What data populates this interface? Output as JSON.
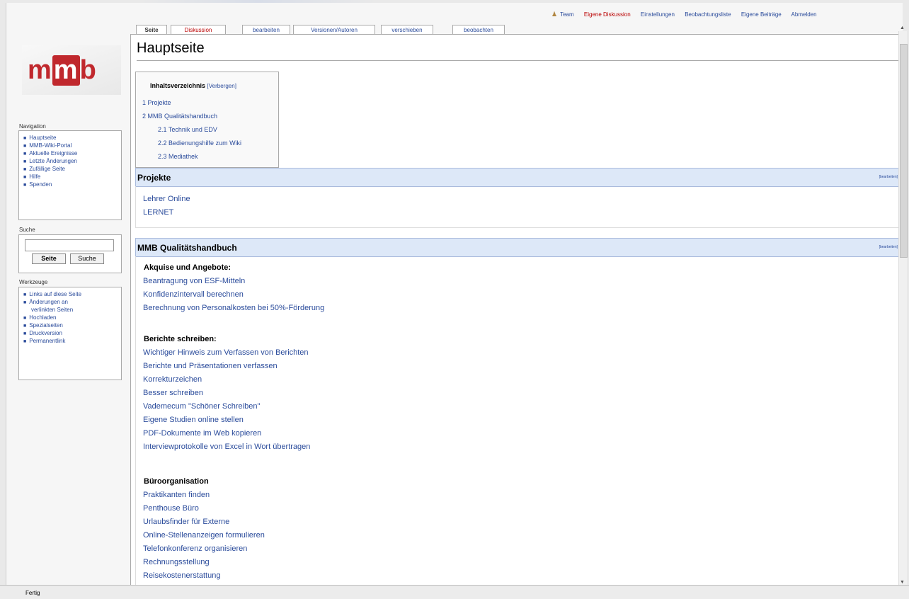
{
  "personal_tools": {
    "user": "Team",
    "talk": "Eigene Diskussion",
    "preferences": "Einstellungen",
    "watchlist": "Beobachtungsliste",
    "contributions": "Eigene Beiträge",
    "logout": "Abmelden"
  },
  "tabs": [
    "Seite",
    "Diskussion",
    "bearbeiten",
    "Versionen/Autoren",
    "verschieben",
    "beobachten"
  ],
  "logo": {
    "text_left": "m",
    "text_box": "m",
    "text_right": "b"
  },
  "sidebar": {
    "navigation_title": "Navigation",
    "navigation": [
      "Hauptseite",
      "MMB-Wiki-Portal",
      "Aktuelle Ereignisse",
      "Letzte Änderungen",
      "Zufällige Seite",
      "Hilfe",
      "Spenden"
    ],
    "search_title": "Suche",
    "search_value": "",
    "go_button": "Seite",
    "search_button": "Suche",
    "tools_title": "Werkzeuge",
    "tools": [
      "Links auf diese Seite",
      "Änderungen an",
      "verlinkten Seiten",
      "Hochladen",
      "Spezialseiten",
      "Druckversion",
      "Permanentlink"
    ]
  },
  "page": {
    "title": "Hauptseite",
    "toc": {
      "title": "Inhaltsverzeichnis",
      "toggle": "[Verbergen]",
      "items": [
        "1 Projekte",
        "2 MMB Qualitätshandbuch",
        "2.1 Technik und EDV",
        "2.2 Bedienungshilfe zum Wiki",
        "2.3 Mediathek"
      ]
    },
    "edit_label": "[bearbeiten]",
    "sections": {
      "projekte": {
        "title": "Projekte",
        "links": [
          "Lehrer Online",
          "LERNET"
        ]
      },
      "handbuch": {
        "title": "MMB Qualitätshandbuch",
        "groups": [
          {
            "heading": "Akquise und Angebote:",
            "links": [
              "Beantragung von ESF-Mitteln",
              "Konfidenzintervall berechnen",
              "Berechnung von Personalkosten bei 50%-Förderung"
            ]
          },
          {
            "heading": "Berichte schreiben:",
            "links": [
              "Wichtiger Hinweis zum Verfassen von Berichten",
              "Berichte und Präsentationen verfassen",
              "Korrekturzeichen",
              "Besser schreiben",
              "Vademecum \"Schöner Schreiben\"",
              "Eigene Studien online stellen",
              "PDF-Dokumente im Web kopieren",
              "Interviewprotokolle von Excel in Wort übertragen"
            ]
          },
          {
            "heading": "Büroorganisation",
            "links": [
              "Praktikanten finden",
              "Penthouse Büro",
              "Urlaubsfinder für Externe",
              "Online-Stellenanzeigen formulieren",
              "Telefonkonferenz organisieren",
              "Rechnungsstellung",
              "Reisekostenerstattung"
            ]
          }
        ]
      }
    }
  },
  "status": {
    "text": "Fertig"
  }
}
